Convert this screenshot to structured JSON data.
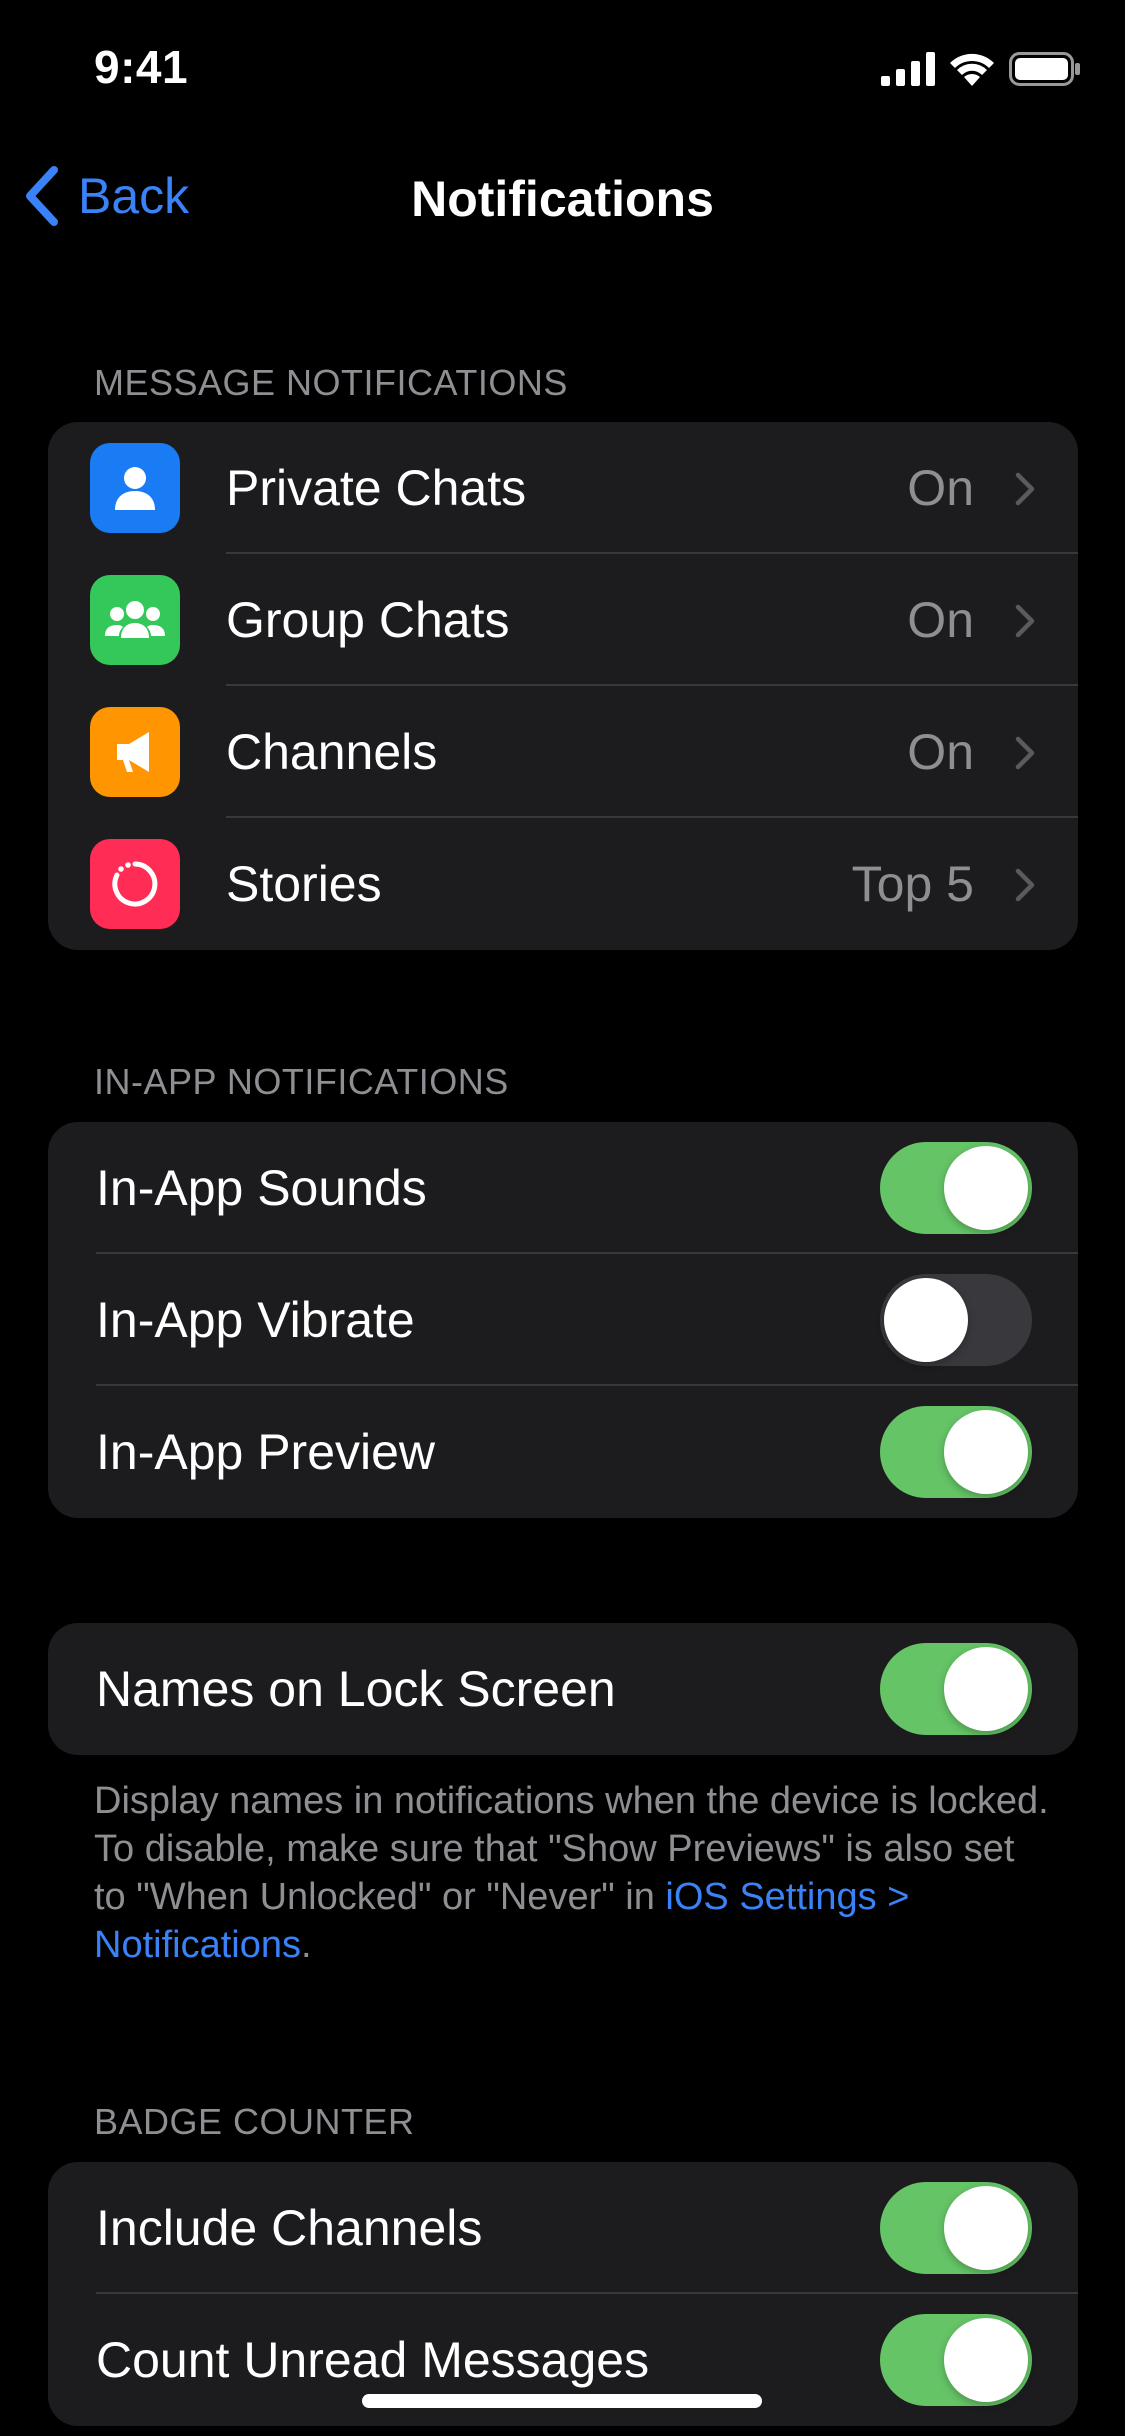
{
  "status_bar": {
    "time": "9:41",
    "icons": [
      "cellular-signal-icon",
      "wifi-icon",
      "battery-icon"
    ]
  },
  "nav": {
    "back_label": "Back",
    "title": "Notifications"
  },
  "message_notifications": {
    "header": "MESSAGE NOTIFICATIONS",
    "items": [
      {
        "label": "Private Chats",
        "value": "On",
        "icon": "person-icon",
        "color": "#1a7cf5"
      },
      {
        "label": "Group Chats",
        "value": "On",
        "icon": "group-icon",
        "color": "#34c759"
      },
      {
        "label": "Channels",
        "value": "On",
        "icon": "megaphone-icon",
        "color": "#ff9500"
      },
      {
        "label": "Stories",
        "value": "Top 5",
        "icon": "stories-icon",
        "color": "#ff2d55"
      }
    ]
  },
  "in_app_notifications": {
    "header": "IN-APP NOTIFICATIONS",
    "items": [
      {
        "label": "In-App Sounds",
        "on": true
      },
      {
        "label": "In-App Vibrate",
        "on": false
      },
      {
        "label": "In-App Preview",
        "on": true
      }
    ]
  },
  "lock_screen": {
    "label": "Names on Lock Screen",
    "on": true,
    "footer_text": "Display names in notifications when the device is locked. To disable, make sure that \"Show Previews\" is also set to \"When Unlocked\" or \"Never\" in ",
    "footer_link": "iOS Settings > Notifications",
    "footer_end": "."
  },
  "badge_counter": {
    "header": "BADGE COUNTER",
    "items": [
      {
        "label": "Include Channels",
        "on": true
      },
      {
        "label": "Count Unread Messages",
        "on": true
      }
    ]
  },
  "colors": {
    "accent": "#3a82f7",
    "toggle_on": "#65c466",
    "toggle_off": "#39393d",
    "cell_bg": "#1c1c1e"
  }
}
